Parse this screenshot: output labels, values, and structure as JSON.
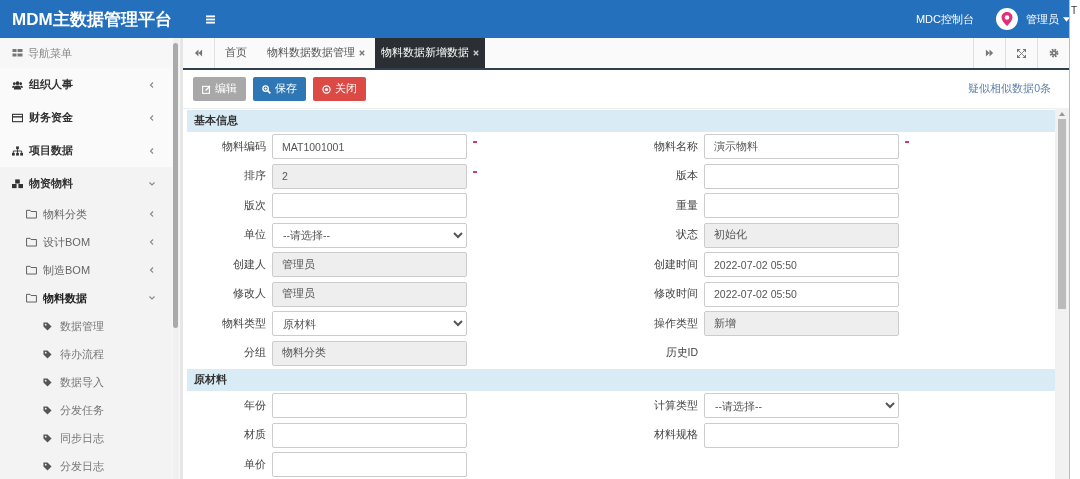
{
  "header": {
    "title": "MDM主数据管理平台",
    "console_link": "MDC控制台",
    "user": "管理员"
  },
  "sidebar": {
    "heading": "导航菜单",
    "items": [
      {
        "label": "组织人事",
        "expanded": false
      },
      {
        "label": "财务资金",
        "expanded": false
      },
      {
        "label": "项目数据",
        "expanded": false
      },
      {
        "label": "物资物料",
        "expanded": true,
        "children": [
          {
            "label": "物料分类",
            "expanded": false
          },
          {
            "label": "设计BOM",
            "expanded": false
          },
          {
            "label": "制造BOM",
            "expanded": false
          },
          {
            "label": "物料数据",
            "expanded": true,
            "children": [
              {
                "label": "数据管理"
              },
              {
                "label": "待办流程"
              },
              {
                "label": "数据导入"
              },
              {
                "label": "分发任务"
              },
              {
                "label": "同步日志"
              },
              {
                "label": "分发日志"
              }
            ]
          }
        ]
      }
    ]
  },
  "tabs": [
    {
      "label": "首页",
      "selected": false,
      "closable": false
    },
    {
      "label": "物料数据数据管理",
      "selected": false,
      "closable": true
    },
    {
      "label": "物料数据新增数据",
      "selected": true,
      "closable": true
    }
  ],
  "toolbar": {
    "buttons": [
      {
        "label": "编辑",
        "kind": "edit",
        "disabled": true
      },
      {
        "label": "保存",
        "kind": "save",
        "disabled": false
      },
      {
        "label": "关闭",
        "kind": "close",
        "disabled": false
      }
    ],
    "similar_link": "疑似相似数据0条"
  },
  "form": {
    "sections": [
      {
        "title": "基本信息",
        "rows": [
          [
            {
              "label": "物料编码",
              "kind": "text",
              "value": "MAT1001001",
              "readonly": false,
              "required": true
            },
            {
              "label": "物料名称",
              "kind": "text",
              "value": "演示物料",
              "readonly": false,
              "required": true
            }
          ],
          [
            {
              "label": "排序",
              "kind": "text",
              "value": "2",
              "readonly": true,
              "required": true
            },
            {
              "label": "版本",
              "kind": "text",
              "readonly": false,
              "required": false
            }
          ],
          [
            {
              "label": "版次",
              "kind": "text",
              "readonly": false,
              "required": false
            },
            {
              "label": "重量",
              "kind": "text",
              "readonly": false,
              "required": false
            }
          ],
          [
            {
              "label": "单位",
              "kind": "select",
              "value": "--请选择--",
              "readonly": false,
              "required": false
            },
            {
              "label": "状态",
              "kind": "text",
              "value": "初始化",
              "readonly": true,
              "required": false
            }
          ],
          [
            {
              "label": "创建人",
              "kind": "text",
              "value": "管理员",
              "readonly": true,
              "required": false
            },
            {
              "label": "创建时间",
              "kind": "text",
              "value": "2022-07-02 05:50",
              "readonly": false,
              "required": false
            }
          ],
          [
            {
              "label": "修改人",
              "kind": "text",
              "value": "管理员",
              "readonly": true,
              "required": false
            },
            {
              "label": "修改时间",
              "kind": "text",
              "value": "2022-07-02 05:50",
              "readonly": false,
              "required": false
            }
          ],
          [
            {
              "label": "物料类型",
              "kind": "select",
              "value": "原材料",
              "readonly": false,
              "required": false
            },
            {
              "label": "操作类型",
              "kind": "text",
              "value": "新增",
              "readonly": true,
              "required": false
            }
          ],
          [
            {
              "label": "分组",
              "kind": "text",
              "value": "物料分类",
              "readonly": true,
              "required": false
            },
            {
              "label": "历史ID",
              "kind": "none"
            }
          ]
        ]
      },
      {
        "title": "原材料",
        "rows": [
          [
            {
              "label": "年份",
              "kind": "text",
              "readonly": false,
              "required": false
            },
            {
              "label": "计算类型",
              "kind": "select",
              "value": "--请选择--",
              "readonly": false,
              "required": false
            }
          ],
          [
            {
              "label": "材质",
              "kind": "text",
              "readonly": false,
              "required": false
            },
            {
              "label": "材料规格",
              "kind": "text",
              "readonly": false,
              "required": false
            }
          ],
          [
            {
              "label": "单价",
              "kind": "text",
              "readonly": false,
              "required": false
            }
          ]
        ]
      }
    ]
  },
  "edge_text": "T"
}
